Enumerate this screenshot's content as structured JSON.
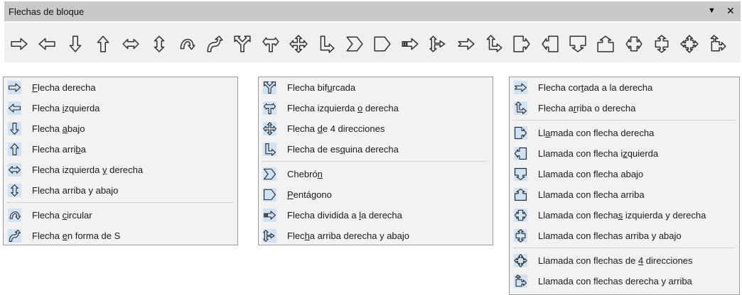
{
  "toolbar": {
    "title": "Flechas de bloque",
    "menu_glyph": "▼",
    "close_glyph": "✕",
    "icons": [
      "right-arrow",
      "left-arrow",
      "down-arrow",
      "up-arrow",
      "left-right-arrow",
      "up-down-arrow",
      "circular-arrow",
      "s-shaped-arrow",
      "split-arrow",
      "left-or-right-arrow",
      "four-way-arrow",
      "corner-right-arrow",
      "chevron",
      "pentagon",
      "striped-right-arrow",
      "up-right-down-arrow",
      "notched-right-arrow",
      "up-right-arrow",
      "right-arrow-callout",
      "left-arrow-callout",
      "down-arrow-callout",
      "up-arrow-callout",
      "left-right-arrow-callout",
      "up-down-arrow-callout",
      "four-way-arrow-callout",
      "up-right-arrow-callout"
    ]
  },
  "menus": [
    {
      "items": [
        {
          "icon": "right-arrow",
          "pre": "",
          "acc": "F",
          "post": "lecha derecha"
        },
        {
          "icon": "left-arrow",
          "pre": "Flecha ",
          "acc": "i",
          "post": "zquierda"
        },
        {
          "icon": "down-arrow",
          "pre": "Flecha ",
          "acc": "a",
          "post": "bajo"
        },
        {
          "icon": "up-arrow",
          "pre": "Flecha arri",
          "acc": "b",
          "post": "a"
        },
        {
          "icon": "left-right-arrow",
          "pre": "Flecha izquierda ",
          "acc": "y",
          "post": " derecha"
        },
        {
          "icon": "up-down-arrow",
          "pre": "Flecha arriba y abajo",
          "acc": "",
          "post": ""
        },
        {
          "icon": "circular-arrow",
          "pre": "Flecha ",
          "acc": "c",
          "post": "ircular"
        },
        {
          "icon": "s-shaped-arrow",
          "pre": "Flecha ",
          "acc": "e",
          "post": "n forma de S"
        }
      ]
    },
    {
      "items": [
        {
          "icon": "split-arrow",
          "pre": "Flecha bif",
          "acc": "u",
          "post": "rcada"
        },
        {
          "icon": "left-or-right-arrow",
          "pre": "Flecha izquierda ",
          "acc": "o",
          "post": " derecha"
        },
        {
          "icon": "four-way-arrow",
          "pre": "Flecha ",
          "acc": "d",
          "post": "e 4 direcciones"
        },
        {
          "icon": "corner-right-arrow",
          "pre": "Flecha de es",
          "acc": "q",
          "post": "uina derecha"
        },
        {
          "icon": "chevron",
          "pre": "Chebró",
          "acc": "n",
          "post": ""
        },
        {
          "icon": "pentagon",
          "pre": "",
          "acc": "P",
          "post": "entágono"
        },
        {
          "icon": "striped-right-arrow",
          "pre": "Flecha dividida a ",
          "acc": "l",
          "post": "a derecha"
        },
        {
          "icon": "up-right-down-arrow",
          "pre": "Flec",
          "acc": "h",
          "post": "a arriba derecha y abajo"
        }
      ]
    },
    {
      "items": [
        {
          "icon": "notched-right-arrow",
          "pre": "Flecha cor",
          "acc": "t",
          "post": "ada a la derecha"
        },
        {
          "icon": "up-right-arrow",
          "pre": "Flecha a",
          "acc": "r",
          "post": "riba o derecha"
        },
        {
          "icon": "right-arrow-callout",
          "pre": "Ll",
          "acc": "a",
          "post": "mada con flecha derecha"
        },
        {
          "icon": "left-arrow-callout",
          "pre": "Llamada con flecha i",
          "acc": "z",
          "post": "quierda"
        },
        {
          "icon": "down-arrow-callout",
          "pre": "Llamada con flecha abajo",
          "acc": "",
          "post": ""
        },
        {
          "icon": "up-arrow-callout",
          "pre": "Llamada con flecha arriba",
          "acc": "",
          "post": ""
        },
        {
          "icon": "left-right-arrow-callout",
          "pre": "Llamada con flecha",
          "acc": "s",
          "post": " izquierda y derecha"
        },
        {
          "icon": "up-down-arrow-callout",
          "pre": "Llamada con flechas arriba y abajo",
          "acc": "",
          "post": ""
        },
        {
          "icon": "four-way-arrow-callout",
          "pre": "Llamada con flechas de ",
          "acc": "4",
          "post": " direcciones"
        },
        {
          "icon": "up-right-arrow-callout",
          "pre": "Llamada con flechas derecha y arriba",
          "acc": "",
          "post": ""
        }
      ]
    }
  ]
}
